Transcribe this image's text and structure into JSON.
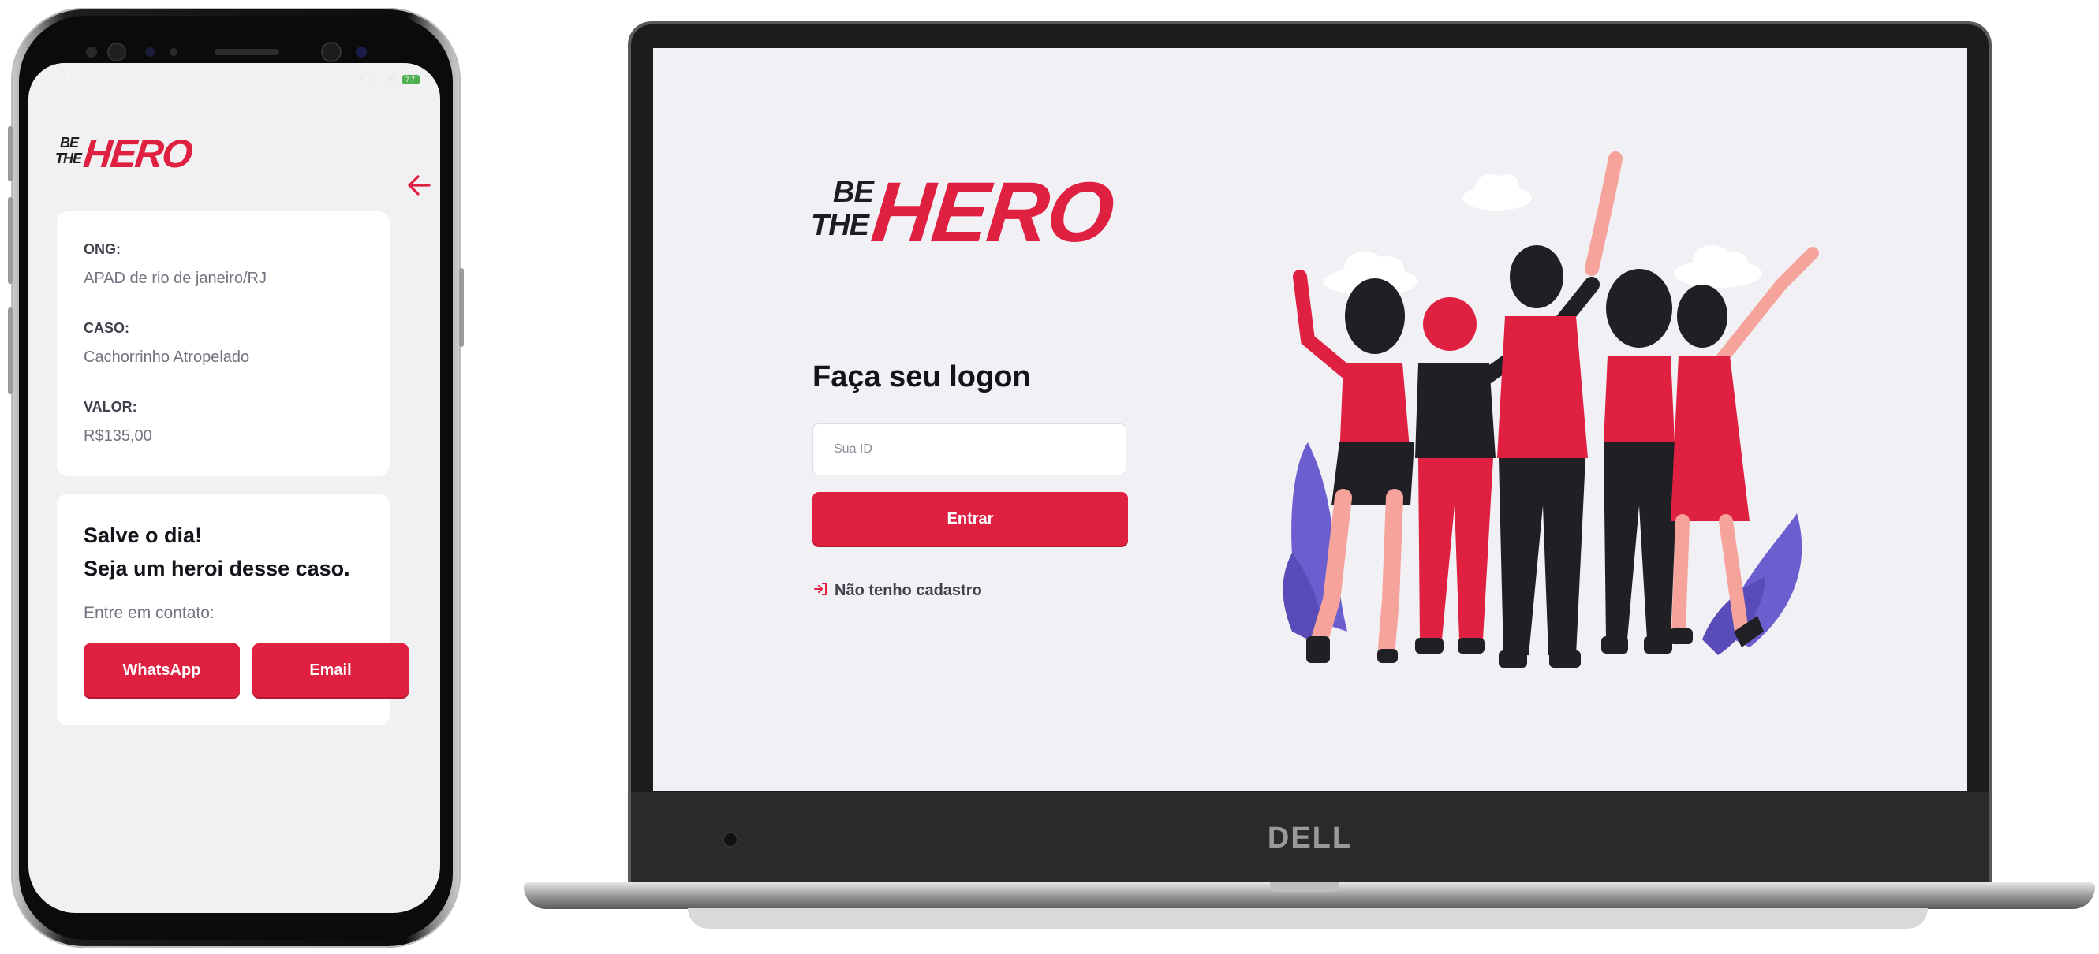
{
  "phone": {
    "status_time": "16:18",
    "logo": {
      "be": "BE",
      "the": "THE",
      "hero": "HERO"
    },
    "incident": {
      "ong_label": "ONG:",
      "ong_value": "APAD de rio de janeiro/RJ",
      "caso_label": "CASO:",
      "caso_value": "Cachorrinho Atropelado",
      "valor_label": "VALOR:",
      "valor_value": "R$135,00"
    },
    "contact": {
      "title_line1": "Salve o dia!",
      "title_line2": "Seja um heroi desse caso.",
      "description": "Entre em contato:",
      "whatsapp_label": "WhatsApp",
      "email_label": "Email"
    }
  },
  "laptop": {
    "brand": "DELL",
    "logo": {
      "be": "BE",
      "the": "THE",
      "hero": "HERO"
    },
    "title": "Faça seu logon",
    "id_placeholder": "Sua ID",
    "id_value": "",
    "submit_label": "Entrar",
    "register_link": "Não tenho cadastro"
  },
  "colors": {
    "brand_red": "#e02041",
    "dark_text": "#13131a",
    "muted_text": "#737380",
    "background": "#f0f0f5",
    "illustration_purple": "#6c5ecf"
  }
}
